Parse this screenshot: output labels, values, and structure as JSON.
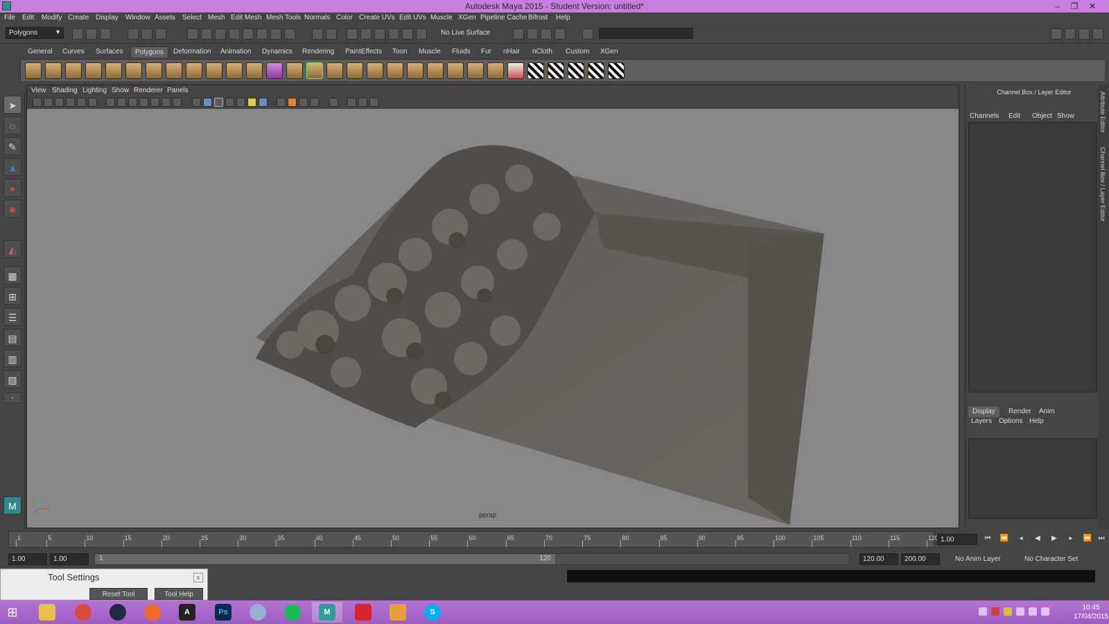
{
  "window": {
    "title": "Autodesk Maya 2015 - Student Version: untitled*"
  },
  "menubar": [
    "File",
    "Edit",
    "Modify",
    "Create",
    "Display",
    "Window",
    "Assets",
    "Select",
    "Mesh",
    "Edit Mesh",
    "Mesh Tools",
    "Normals",
    "Color",
    "Create UVs",
    "Edit UVs",
    "Muscle",
    "XGen",
    "Pipeline Cache",
    "Bifrost",
    "Help"
  ],
  "statusline": {
    "mode": "Polygons",
    "live_surface": "No Live Surface"
  },
  "shelf_tabs": {
    "active": "Polygons",
    "items": [
      "General",
      "Curves",
      "Surfaces",
      "Polygons",
      "Deformation",
      "Animation",
      "Dynamics",
      "Rendering",
      "PaintEffects",
      "Toon",
      "Muscle",
      "Fluids",
      "Fur",
      "nHair",
      "nCloth",
      "Custom",
      "XGen"
    ]
  },
  "panel": {
    "menus": [
      "View",
      "Shading",
      "Lighting",
      "Show",
      "Renderer",
      "Panels"
    ],
    "camera": "persp"
  },
  "channel_box": {
    "title": "Channel Box / Layer Editor",
    "menus": [
      "Channels",
      "Edit",
      "Object",
      "Show"
    ]
  },
  "layer_editor": {
    "tabs": [
      "Display",
      "Render",
      "Anim"
    ],
    "active_tab": "Display",
    "menus": [
      "Layers",
      "Options",
      "Help"
    ]
  },
  "side_tabs": [
    "Attribute Editor",
    "Channel Box / Layer Editor"
  ],
  "timeline": {
    "ticks": [
      "1",
      "5",
      "10",
      "15",
      "20",
      "25",
      "30",
      "35",
      "40",
      "45",
      "50",
      "55",
      "60",
      "65",
      "70",
      "75",
      "80",
      "85",
      "90",
      "95",
      "100",
      "105",
      "110",
      "115",
      "120"
    ],
    "current_frame": "1.00"
  },
  "range": {
    "start": "1.00",
    "start_inner": "1.00",
    "handle_start": "1",
    "handle_end": "120",
    "end_inner": "120.00",
    "end": "200.00",
    "anim_layer": "No Anim Layer",
    "character_set": "No Character Set"
  },
  "tool_settings": {
    "title": "Tool Settings",
    "reset": "Reset Tool",
    "help": "Tool Help"
  },
  "taskbar": {
    "time": "10:45",
    "date": "17/04/2015"
  },
  "colors": {
    "titlebar": "#c77ee0",
    "taskbar": "#a866c8",
    "viewport": "#878787"
  }
}
